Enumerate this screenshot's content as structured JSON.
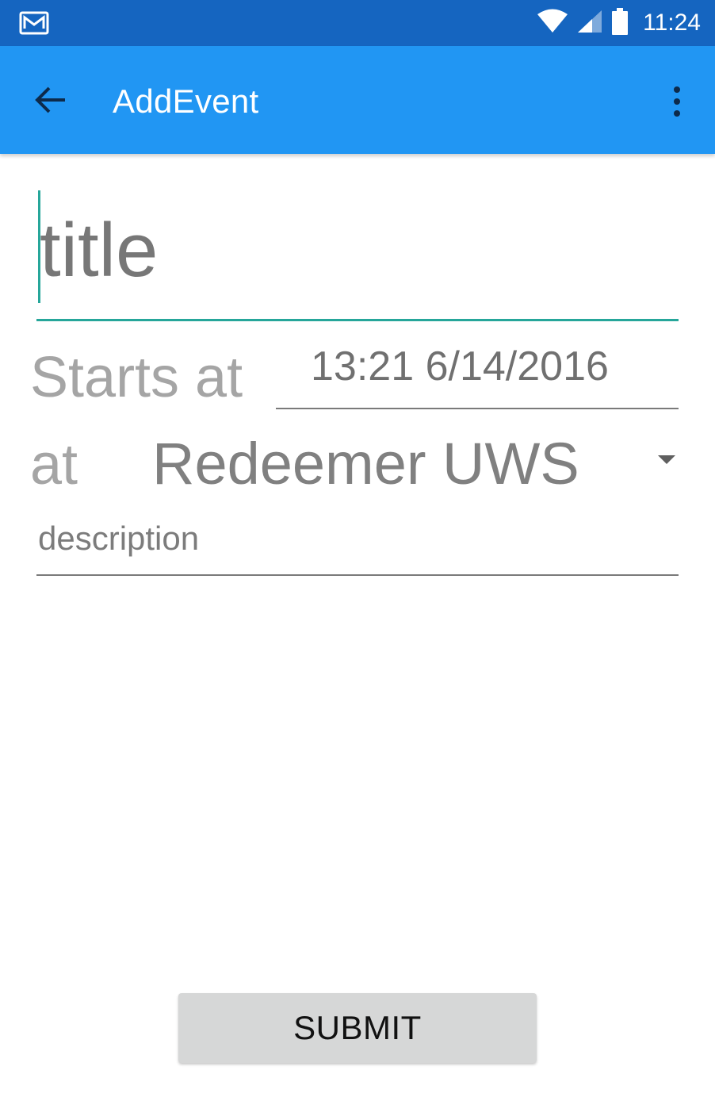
{
  "status_bar": {
    "time": "11:24",
    "icons": [
      "gmail-icon",
      "wifi-icon",
      "cell-signal-icon",
      "battery-icon"
    ],
    "background": "#1565c0"
  },
  "app_bar": {
    "title": "AddEvent",
    "back_icon": "arrow-back-icon",
    "overflow_icon": "more-vert-icon",
    "background": "#2196f3"
  },
  "form": {
    "title_placeholder": "title",
    "starts_label": "Starts at",
    "start_datetime": "13:21 6/14/2016",
    "location_label": "at",
    "location_selected": "Redeemer UWS",
    "description_placeholder": "description",
    "accent_color": "#26a69a"
  },
  "actions": {
    "submit_label": "SUBMIT"
  }
}
